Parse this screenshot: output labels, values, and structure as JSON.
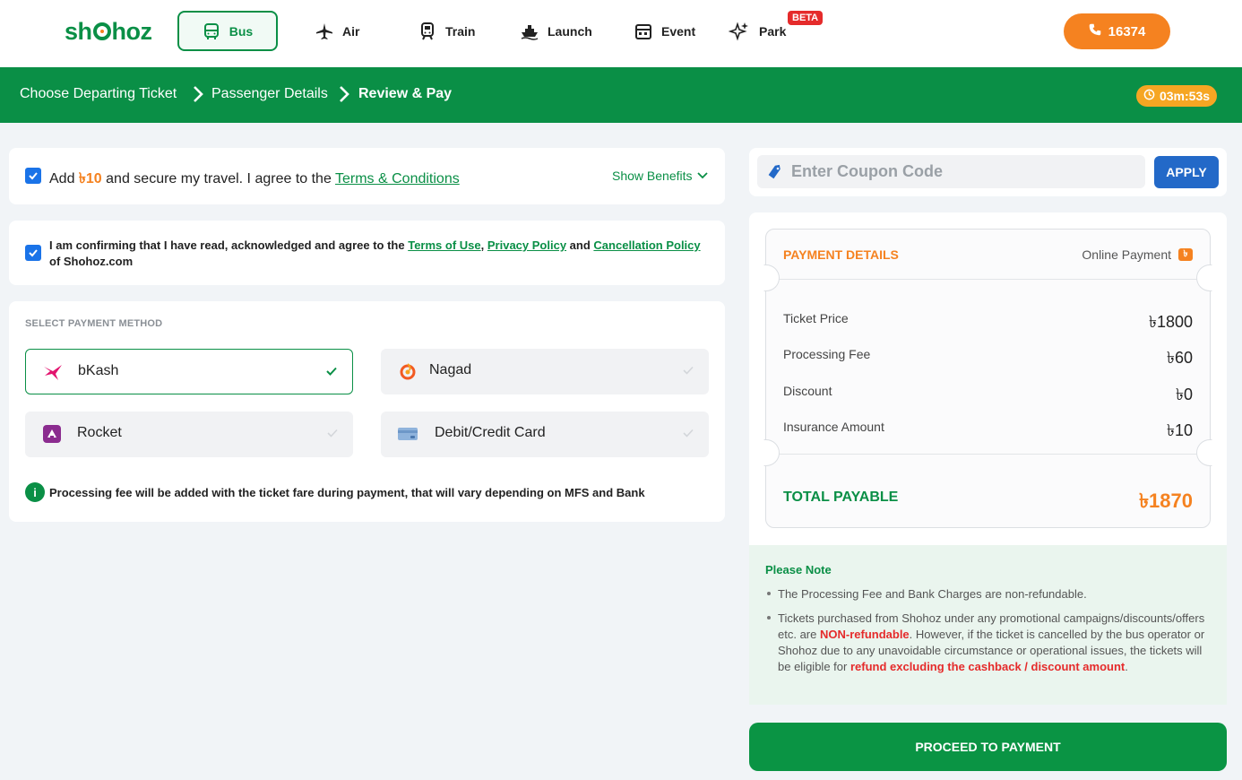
{
  "logo": {
    "left": "sh",
    "right": "hoz"
  },
  "nav": {
    "items": [
      {
        "label": "Bus",
        "icon": "bus-icon"
      },
      {
        "label": "Air",
        "icon": "plane-icon"
      },
      {
        "label": "Train",
        "icon": "train-icon"
      },
      {
        "label": "Launch",
        "icon": "ship-icon"
      },
      {
        "label": "Event",
        "icon": "event-icon"
      },
      {
        "label": "Park",
        "icon": "sparkle-icon"
      }
    ],
    "beta": "BETA",
    "phone": "16374"
  },
  "breadcrumb": {
    "step1": "Choose Departing Ticket",
    "step2": "Passenger Details",
    "step3": "Review & Pay",
    "timer": "03m:53s"
  },
  "insurance": {
    "prefix": "Add",
    "amount": "৳10",
    "middle": "and secure my travel. I agree to the",
    "link": "Terms & Conditions",
    "show_benefits": "Show Benefits"
  },
  "agreement": {
    "prefix": "I am confirming that I have read, acknowledged and agree to the",
    "terms": "Terms of Use",
    "comma": ",",
    "privacy": "Privacy Policy",
    "and": "and",
    "cancellation": "Cancellation Policy",
    "suffix": "of Shohoz.com"
  },
  "payment": {
    "title": "SELECT PAYMENT METHOD",
    "methods": [
      "bKash",
      "Nagad",
      "Rocket",
      "Debit/Credit Card"
    ],
    "selected": "bKash",
    "info": "Processing fee will be added with the ticket fare during payment, that will vary depending on MFS and Bank"
  },
  "coupon": {
    "placeholder": "Enter Coupon Code",
    "apply": "APPLY"
  },
  "details": {
    "title": "PAYMENT DETAILS",
    "mode": "Online Payment",
    "mode_badge": "৳",
    "rows": [
      {
        "label": "Ticket Price",
        "value": "৳1800"
      },
      {
        "label": "Processing Fee",
        "value": "৳60"
      },
      {
        "label": "Discount",
        "value": "৳0"
      },
      {
        "label": "Insurance Amount",
        "value": "৳10"
      }
    ],
    "total_label": "TOTAL PAYABLE",
    "total_value": "৳1870"
  },
  "note": {
    "title": "Please Note",
    "item1": "The Processing Fee and Bank Charges are non-refundable.",
    "item2a": "Tickets purchased from Shohoz under any promotional campaigns/discounts/offers etc. are",
    "item2b": "NON-refundable",
    "item2c": ". However, if the ticket is cancelled by the bus operator or Shohoz due to any unavoidable circumstance or operational issues, the tickets will be eligible for",
    "item2d": "refund excluding the cashback / discount amount",
    "item2e": "."
  },
  "proceed": "PROCEED TO PAYMENT",
  "colors": {
    "brand_green": "#0a8f46",
    "accent_orange": "#f58220",
    "apply_blue": "#2369c8",
    "alert_red": "#e52b2b"
  }
}
